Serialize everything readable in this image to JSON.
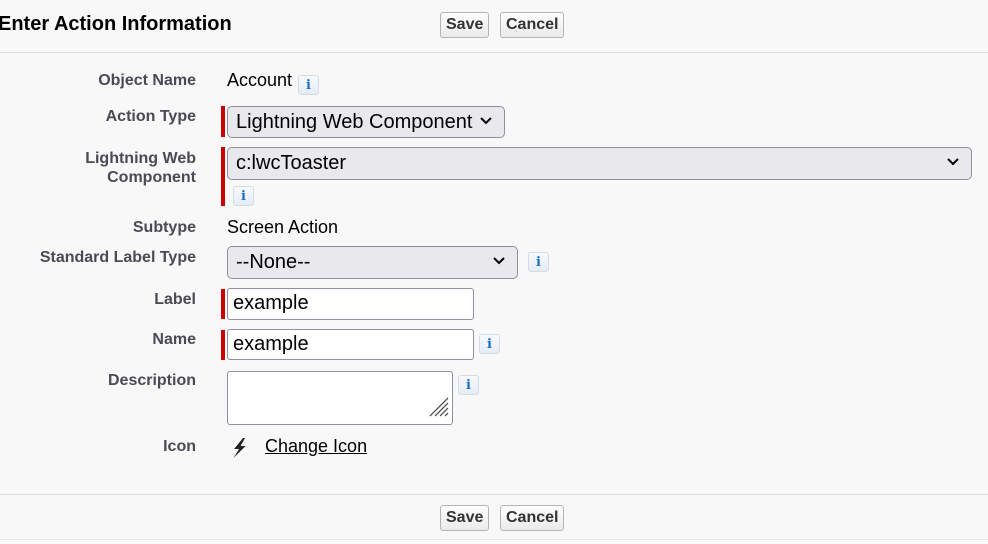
{
  "header": {
    "title": "Enter Action Information",
    "save_label": "Save",
    "cancel_label": "Cancel"
  },
  "form": {
    "object_name": {
      "label": "Object Name",
      "value": "Account",
      "info_icon": "info-icon"
    },
    "action_type": {
      "label": "Action Type",
      "value": "Lightning Web Component",
      "required": true
    },
    "lightning_web_component": {
      "label_line1": "Lightning Web",
      "label_line2": "Component",
      "value": "c:lwcToaster",
      "required": true,
      "info_icon": "info-icon"
    },
    "subtype": {
      "label": "Subtype",
      "value": "Screen Action"
    },
    "standard_label_type": {
      "label": "Standard Label Type",
      "value": "--None--",
      "info_icon": "info-icon"
    },
    "label": {
      "label": "Label",
      "value": "example",
      "required": true
    },
    "name": {
      "label": "Name",
      "value": "example",
      "required": true,
      "info_icon": "info-icon"
    },
    "description": {
      "label": "Description",
      "value": "",
      "info_icon": "info-icon"
    },
    "icon": {
      "label": "Icon",
      "icon_name": "lightning-bolt-icon",
      "link_label": "Change Icon"
    }
  },
  "info_glyph": "i",
  "footer": {
    "save_label": "Save",
    "cancel_label": "Cancel"
  },
  "colors": {
    "required_bar": "#cc0000",
    "info_icon": "#1a6fc4",
    "label_text": "#4a4a56"
  }
}
